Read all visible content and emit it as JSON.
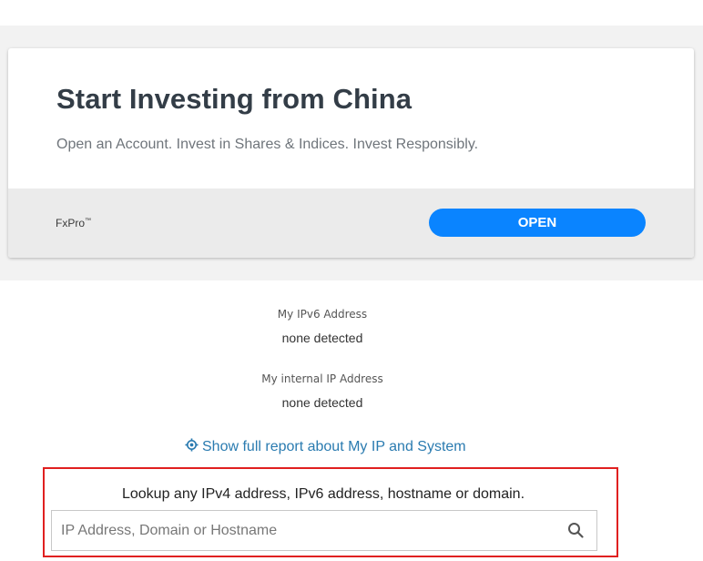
{
  "ad": {
    "title": "Start Investing from China",
    "description": "Open an Account. Invest in Shares & Indices. Invest Responsibly.",
    "brand": "FxPro",
    "brand_mark": "™",
    "open_label": "OPEN",
    "button_color": "#0a84ff"
  },
  "info": {
    "ipv6_label": "My IPv6 Address",
    "ipv6_value": "none detected",
    "internal_label": "My internal IP Address",
    "internal_value": "none detected"
  },
  "report": {
    "link_label": "Show full report about My IP and System",
    "icon": "crosshair-icon"
  },
  "lookup": {
    "prompt": "Lookup any IPv4 address, IPv6 address, hostname or domain.",
    "placeholder": "IP Address, Domain or Hostname",
    "value": "",
    "icon": "search-icon",
    "highlight_color": "#e02020"
  }
}
